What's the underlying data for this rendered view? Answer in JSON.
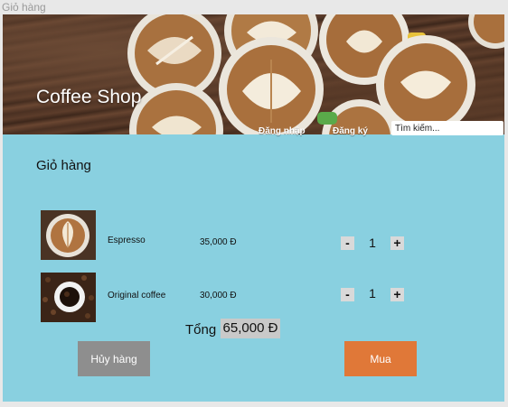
{
  "window": {
    "title": "Giỏ hàng"
  },
  "header": {
    "brand": "Coffee Shop",
    "nav": {
      "login": "Đăng nhập",
      "register": "Đăng ký"
    },
    "search": {
      "placeholder": "Tìm kiếm..."
    }
  },
  "cart": {
    "title": "Giỏ hàng",
    "items": [
      {
        "name": "Espresso",
        "price": "35,000 Đ",
        "quantity": "1",
        "minus": "-",
        "plus": "+"
      },
      {
        "name": "Original coffee",
        "price": "30,000 Đ",
        "quantity": "1",
        "minus": "-",
        "plus": "+"
      }
    ],
    "total_label": "Tổng",
    "total_value": "65,000 Đ",
    "cancel_label": "Hủy hàng",
    "buy_label": "Mua"
  },
  "colors": {
    "background": "#89d0e0",
    "cancel_button": "#8e8e8e",
    "buy_button": "#e07838",
    "qty_button": "#d9d9d9"
  }
}
